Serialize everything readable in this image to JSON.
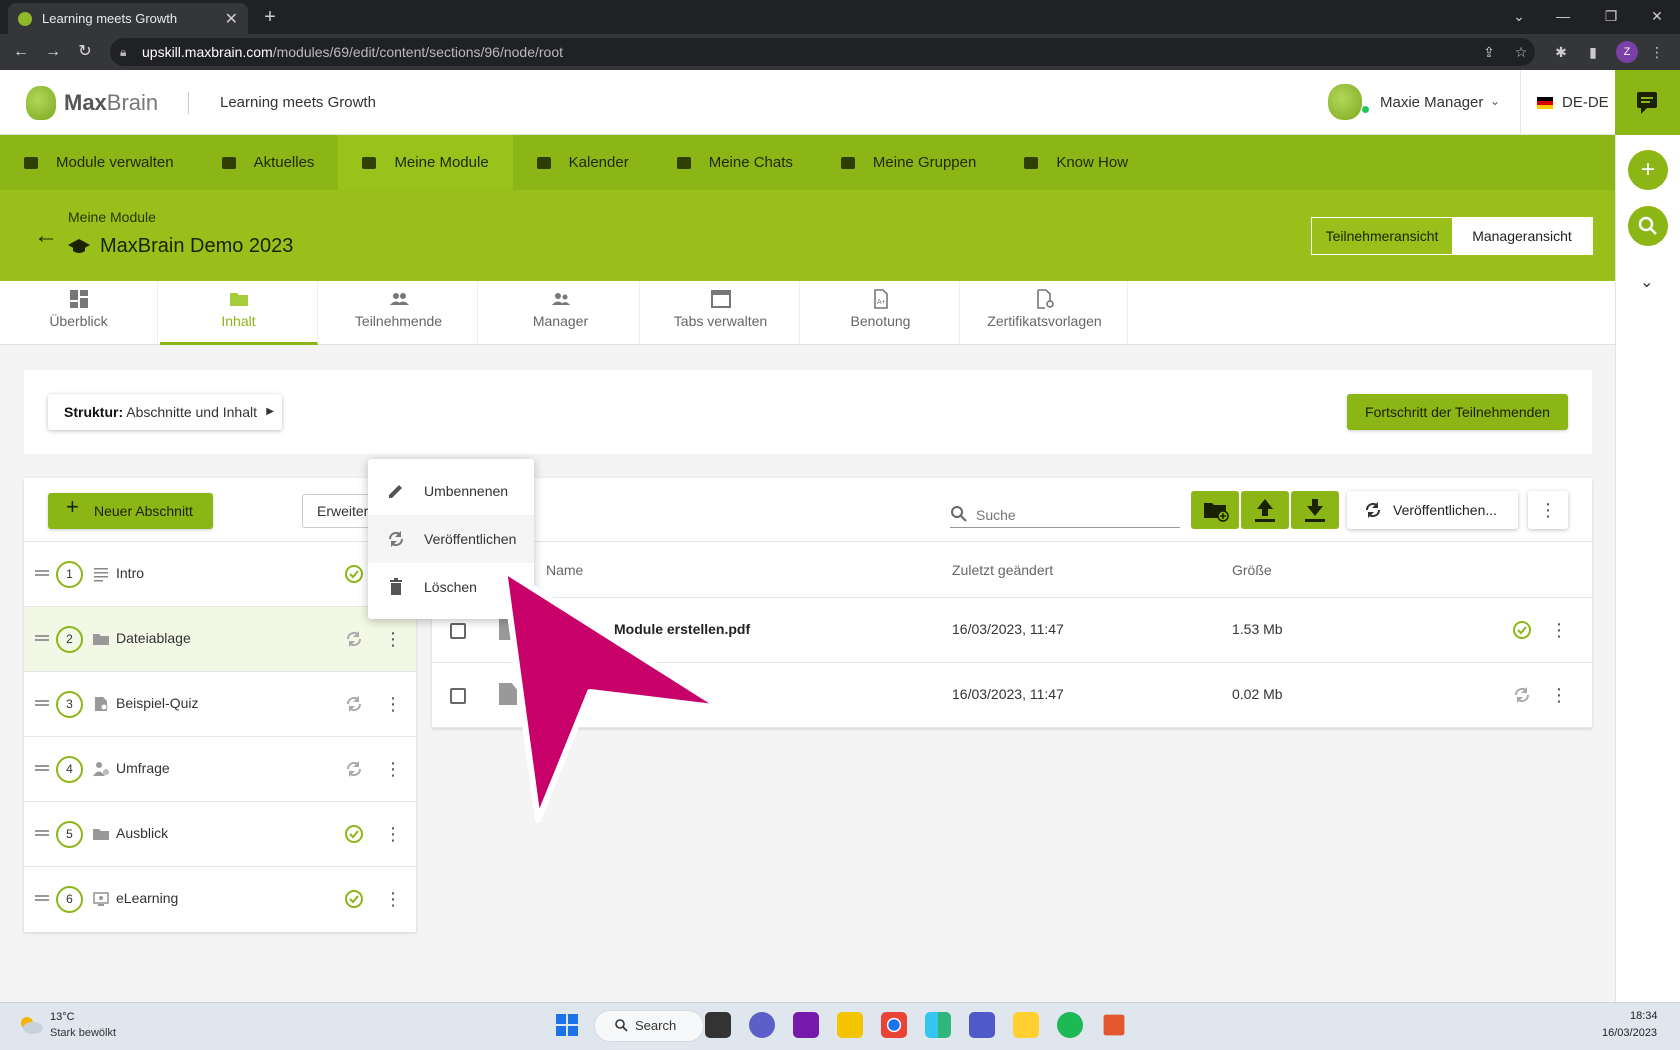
{
  "browser": {
    "tab_title": "Learning meets Growth",
    "url_host": "upskill.maxbrain.com",
    "url_path": "/modules/69/edit/content/sections/96/node/root",
    "profile_initial": "Z"
  },
  "header": {
    "logo_bold": "Max",
    "logo_light": "Brain",
    "tagline": "Learning meets Growth",
    "user_name": "Maxie Manager",
    "language": "DE-DE"
  },
  "main_nav": {
    "items": [
      {
        "label": "Module verwalten",
        "icon": "briefcase-icon"
      },
      {
        "label": "Aktuelles",
        "icon": "news-icon"
      },
      {
        "label": "Meine Module",
        "icon": "graduation-cap-icon",
        "active": true
      },
      {
        "label": "Kalender",
        "icon": "calendar-icon"
      },
      {
        "label": "Meine Chats",
        "icon": "chat-icon"
      },
      {
        "label": "Meine Gruppen",
        "icon": "group-icon"
      },
      {
        "label": "Know How",
        "icon": "book-icon"
      }
    ]
  },
  "module": {
    "breadcrumb": "Meine Module",
    "title": "MaxBrain Demo 2023",
    "view_participant": "Teilnehmeransicht",
    "view_manager": "Manageransicht"
  },
  "content_tabs": [
    {
      "label": "Überblick",
      "icon": "dashboard-icon"
    },
    {
      "label": "Inhalt",
      "icon": "folder-icon",
      "active": true
    },
    {
      "label": "Teilnehmende",
      "icon": "people-icon"
    },
    {
      "label": "Manager",
      "icon": "manager-icon"
    },
    {
      "label": "Tabs verwalten",
      "icon": "window-icon"
    },
    {
      "label": "Benotung",
      "icon": "grade-file-icon"
    },
    {
      "label": "Zertifikatsvorlagen",
      "icon": "certificate-file-icon"
    }
  ],
  "structure": {
    "label_bold": "Struktur:",
    "label_value": "Abschnitte und Inhalt",
    "progress_button": "Fortschritt der Teilnehmenden"
  },
  "sections_panel": {
    "new_section": "Neuer Abschnitt",
    "advanced": "Erweitert",
    "items": [
      {
        "num": "1",
        "name": "Intro",
        "icon": "text-lines-icon",
        "status": "published"
      },
      {
        "num": "2",
        "name": "Dateiablage",
        "icon": "folder-icon",
        "status": "unpublished",
        "selected": true
      },
      {
        "num": "3",
        "name": "Beispiel-Quiz",
        "icon": "quiz-icon",
        "status": "unpublished"
      },
      {
        "num": "4",
        "name": "Umfrage",
        "icon": "survey-icon",
        "status": "unpublished"
      },
      {
        "num": "5",
        "name": "Ausblick",
        "icon": "folder-icon",
        "status": "published"
      },
      {
        "num": "6",
        "name": "eLearning",
        "icon": "elearning-icon",
        "status": "published"
      }
    ]
  },
  "files_panel": {
    "search_placeholder": "Suche",
    "publish_button": "Veröffentlichen...",
    "columns": {
      "name": "Name",
      "modified": "Zuletzt geändert",
      "size": "Größe"
    },
    "rows": [
      {
        "name": "Module erstellen.pdf",
        "modified": "16/03/2023, 11:47",
        "size": "1.53 Mb",
        "status": "published"
      },
      {
        "name": "",
        "modified": "16/03/2023, 11:47",
        "size": "0.02 Mb",
        "status": "unpublished"
      }
    ]
  },
  "context_menu": {
    "items": [
      {
        "label": "Umbennenen",
        "icon": "pencil-icon"
      },
      {
        "label": "Veröffentlichen",
        "icon": "sync-icon"
      },
      {
        "label": "Löschen",
        "icon": "trash-icon"
      }
    ]
  },
  "taskbar": {
    "temperature": "13°C",
    "weather": "Stark bewölkt",
    "search": "Search",
    "time": "18:34",
    "date": "16/03/2023"
  },
  "colors": {
    "brand_green": "#8cb516",
    "header_green": "#99c01a",
    "arrow_magenta": "#c8006a"
  }
}
